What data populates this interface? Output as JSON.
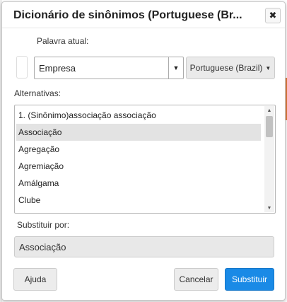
{
  "dialog": {
    "title": "Dicionário de sinônimos (Portuguese (Br...",
    "close_label": "✖"
  },
  "current_word": {
    "label": "Palavra atual:",
    "value": "Empresa",
    "language_button": "Portuguese (Brazil)"
  },
  "alternatives": {
    "label": "Alternativas:",
    "items": [
      "1. (Sinônimo)associação associação",
      "Associação",
      "Agregação",
      "Agremiação",
      "Amálgama",
      "Clube"
    ],
    "selected_index": 1
  },
  "replace": {
    "label": "Substituir por:",
    "value": "Associação"
  },
  "buttons": {
    "help": "Ajuda",
    "cancel": "Cancelar",
    "replace": "Substituir"
  },
  "colors": {
    "primary": "#1a8ae6",
    "selected_row": "#e3e3e3"
  }
}
